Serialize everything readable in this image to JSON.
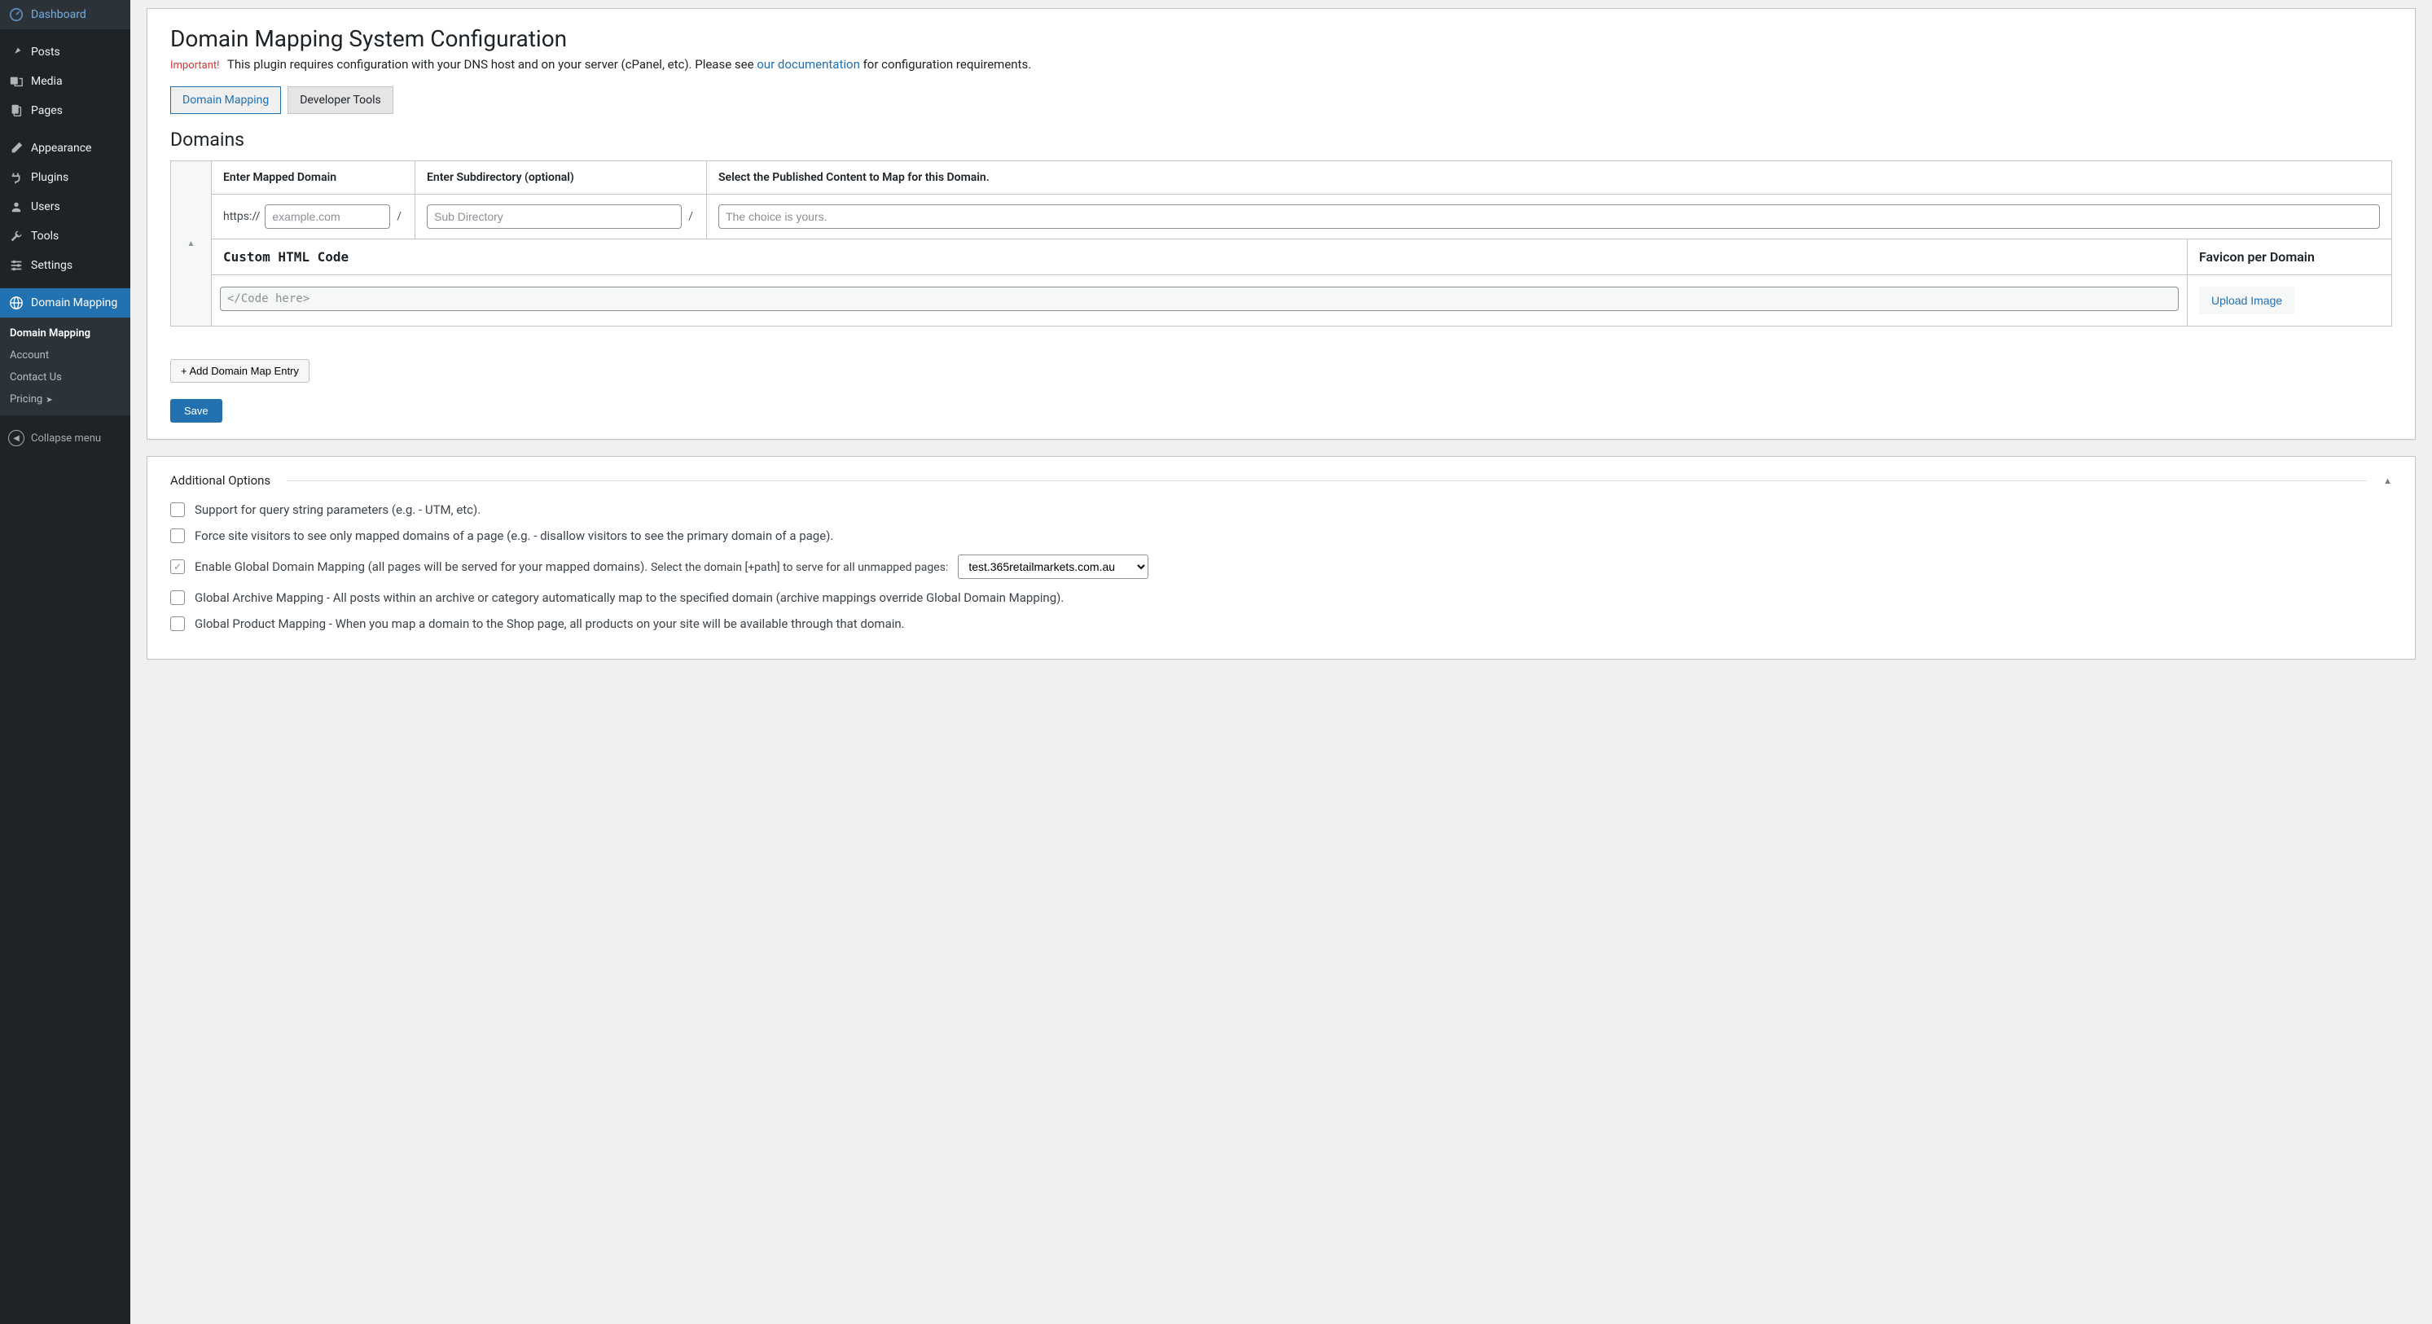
{
  "sidebar": {
    "items": [
      {
        "label": "Dashboard",
        "icon": "dashboard"
      },
      {
        "label": "Posts",
        "icon": "pin"
      },
      {
        "label": "Media",
        "icon": "media"
      },
      {
        "label": "Pages",
        "icon": "pages"
      },
      {
        "label": "Appearance",
        "icon": "brush"
      },
      {
        "label": "Plugins",
        "icon": "plug"
      },
      {
        "label": "Users",
        "icon": "user"
      },
      {
        "label": "Tools",
        "icon": "wrench"
      },
      {
        "label": "Settings",
        "icon": "sliders"
      },
      {
        "label": "Domain Mapping",
        "icon": "globe",
        "active": true
      }
    ],
    "submenu": [
      {
        "label": "Domain Mapping",
        "current": true
      },
      {
        "label": "Account"
      },
      {
        "label": "Contact Us"
      },
      {
        "label": "Pricing",
        "arrow": true
      }
    ],
    "collapse": "Collapse menu"
  },
  "page": {
    "title": "Domain Mapping System Configuration",
    "important": "Important!",
    "notice": "This plugin requires configuration with your DNS host and on your server (cPanel, etc). Please see ",
    "doclink": "our documentation",
    "notice_after": " for configuration requirements."
  },
  "tabs": [
    {
      "label": "Domain Mapping",
      "active": true
    },
    {
      "label": "Developer Tools"
    }
  ],
  "domains": {
    "title": "Domains",
    "headers": {
      "mapped": "Enter Mapped Domain",
      "subdir": "Enter Subdirectory (optional)",
      "content": "Select the Published Content to Map for this Domain."
    },
    "protocol": "https://",
    "slash": "/",
    "placeholders": {
      "domain": "example.com",
      "subdir": "Sub Directory",
      "content": "The choice is yours.",
      "code": "</Code here>"
    },
    "sub_headers": {
      "code": "Custom HTML Code",
      "favicon": "Favicon per Domain"
    },
    "upload": "Upload Image",
    "add_entry": "+ Add Domain Map Entry",
    "save": "Save"
  },
  "options": {
    "title": "Additional Options",
    "rows": {
      "query": "Support for query string parameters (e.g. - UTM, etc).",
      "force": "Force site visitors to see only mapped domains of a page (e.g. - disallow visitors to see the primary domain of a page).",
      "global_pre": "Enable Global Domain Mapping (all pages will be served for your mapped domains). ",
      "global_post": "Select the domain [+path] to serve for all unmapped pages:",
      "archive": "Global Archive Mapping - All posts within an archive or category automatically map to the specified domain (archive mappings override Global Domain Mapping).",
      "product": "Global Product Mapping - When you map a domain to the Shop page, all products on your site will be available through that domain."
    },
    "select_value": "test.365retailmarkets.com.au",
    "global_checked": true
  }
}
